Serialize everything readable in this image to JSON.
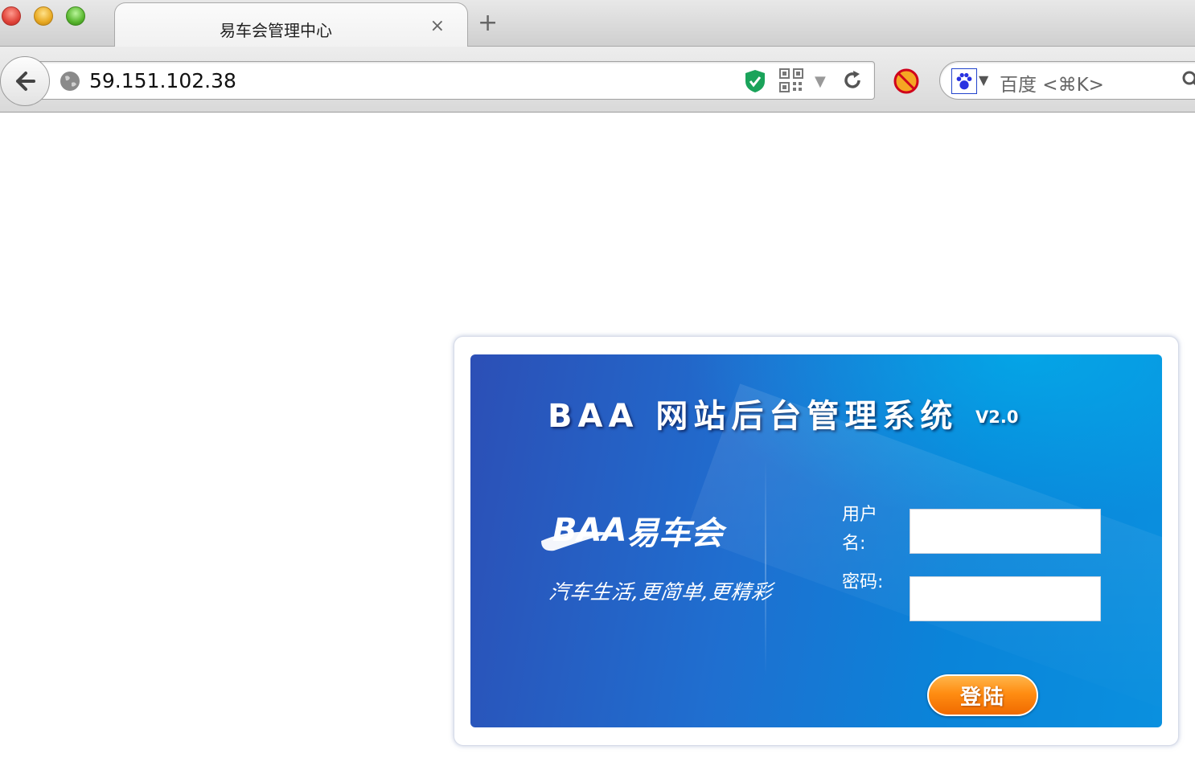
{
  "browser": {
    "tab": {
      "title": "易车会管理中心",
      "close_symbol": "×"
    },
    "new_tab_symbol": "+",
    "address_bar": {
      "url": "59.151.102.38"
    },
    "search": {
      "engine_icon": "baidu-paw-icon",
      "placeholder": "百度 <⌘K>"
    },
    "icons": [
      "back-arrow-icon",
      "globe-icon",
      "security-shield-icon",
      "qr-code-icon",
      "dropdown-arrow-icon",
      "reload-icon",
      "adblock-icon",
      "search-icon"
    ]
  },
  "login": {
    "system_title": "BAA 网站后台管理系统",
    "version": "V2.0",
    "logo_text": "易车会",
    "slogan": "汽车生活,更简单,更精彩",
    "username_label": "用户名:",
    "password_label": "密码:",
    "username_value": "",
    "password_value": "",
    "submit_label": "登陆"
  },
  "colors": {
    "panel_blue": "#1f6fd0",
    "accent_cyan": "#00bef0",
    "button_orange": "#ff8d12"
  }
}
